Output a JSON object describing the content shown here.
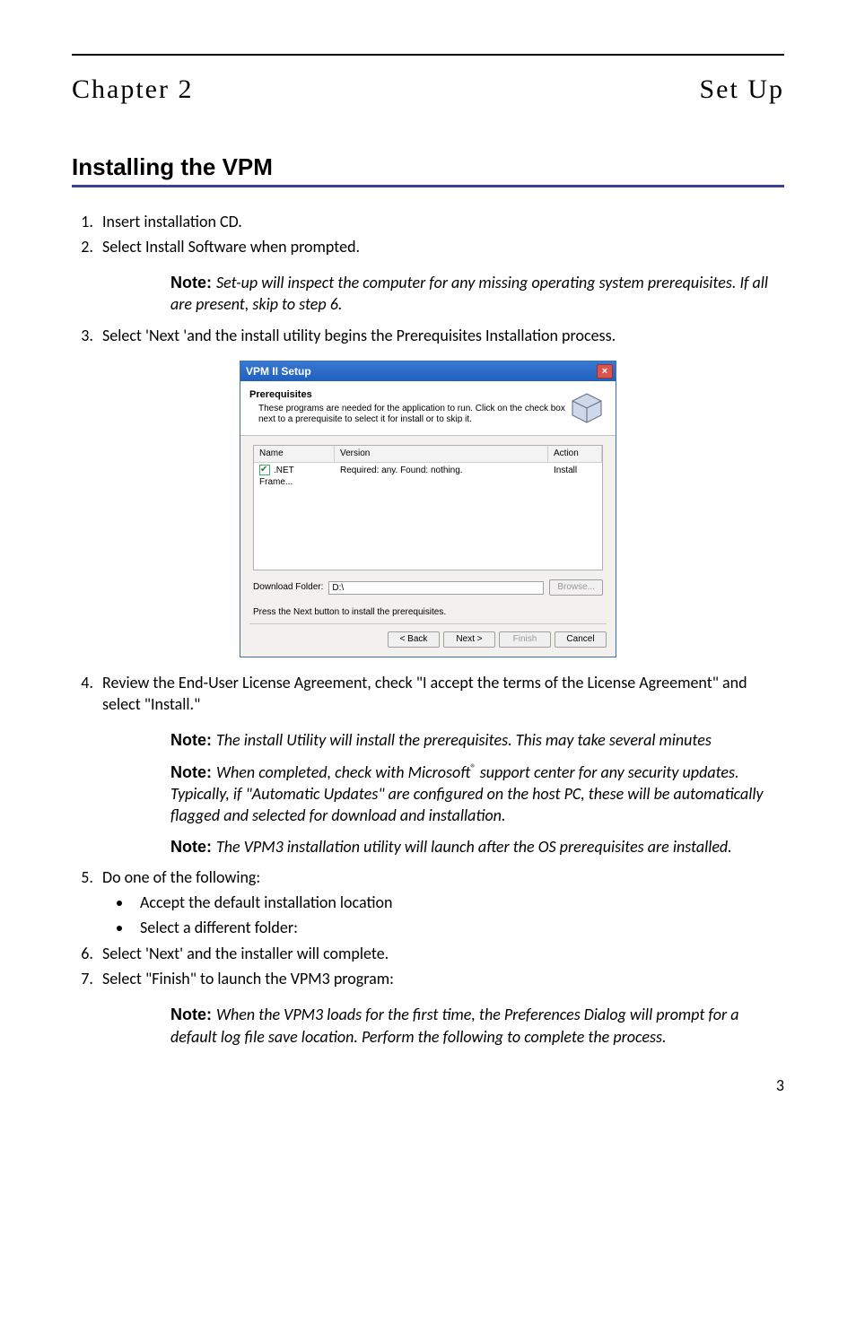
{
  "chapter_label": "Chapter 2",
  "chapter_title": "Set Up",
  "section_title": "Installing the VPM",
  "steps": {
    "s1": "Insert installation CD.",
    "s2": "Select Install Software when prompted.",
    "s3": "Select 'Next 'and the install utility begins the Prerequisites Installation process.",
    "s4": "Review the End-User License Agreement, check \"I accept the terms of the License Agreement\" and select \"Install.\"",
    "s5": "Do one of the following:",
    "s5_b1": "Accept the default installation location",
    "s5_b2": "Select a different folder:",
    "s6": "Select 'Next' and the installer will complete.",
    "s7": "Select \"Finish\" to launch the VPM3 program:"
  },
  "notes": {
    "lead": "Note:  ",
    "n1": "Set-up will inspect the computer for any missing operating system prerequisites. If all are present, skip to step 6.",
    "n2": "The install Utility will install the prerequisites. This may take several minutes",
    "n3a": "When completed, check with Microsoft",
    "n3b": " support center for any security updates. Typically, if \"Automatic Updates\" are configured on the host PC, these will be automatically flagged and selected for download and installation.",
    "n4": "The VPM3 installation utility will launch after the OS prerequisites are installed.",
    "n5": "When the VPM3 loads for the first time, the Preferences Dialog will prompt for a default log file save location. Perform the following to complete the process."
  },
  "dialog": {
    "title": "VPM II Setup",
    "header_title": "Prerequisites",
    "header_sub": "These programs are needed for the application to run. Click on the check box next to a prerequisite to select it for install or to skip it.",
    "col_name": "Name",
    "col_version": "Version",
    "col_action": "Action",
    "row_name": ".NET Frame...",
    "row_version": "Required: any. Found: nothing.",
    "row_action": "Install",
    "download_label": "Download Folder:",
    "download_value": "D:\\",
    "browse": "Browse...",
    "press_line": "Press the Next button to install the prerequisites.",
    "btn_back": "< Back",
    "btn_next": "Next >",
    "btn_finish": "Finish",
    "btn_cancel": "Cancel"
  },
  "page_number": "3"
}
